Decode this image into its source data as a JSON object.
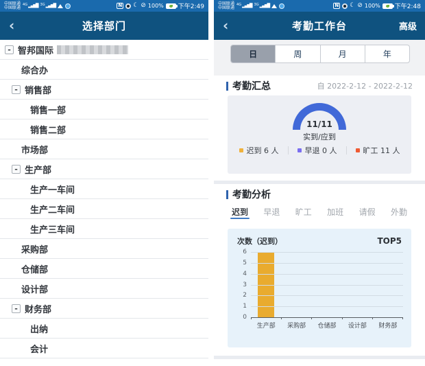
{
  "colors": {
    "status_bar_blue": "#1a6aad",
    "header_blue": "#0f527f",
    "section_bar_blue": "#2f63ad",
    "tab_underline_blue": "#3f7ac4",
    "gauge_blue": "#4169d8",
    "bar_yellow": "#e9ab2f",
    "legend_late_yellow": "#f0b23c",
    "legend_early_purple": "#7b6ef0",
    "legend_absent_red": "#ef5a33"
  },
  "glyphs": {
    "back": "‹",
    "minus": "-",
    "signal": "▂▄▆█",
    "nfc": "N",
    "moon": "☾",
    "mute": "⊘"
  },
  "left_screen": {
    "status": {
      "carrier_line1": "中国联通",
      "carrier_line2": "中国联通",
      "net1": "4G",
      "net2": "3G",
      "battery": "100%",
      "time": "下午2:49"
    },
    "header": {
      "title": "选择部门"
    },
    "tree": [
      {
        "label": "智邦国际",
        "level": 0,
        "expanded": true,
        "suffix_masked": true
      },
      {
        "label": "综合办",
        "level": 1
      },
      {
        "label": "销售部",
        "level": 1,
        "expanded": true
      },
      {
        "label": "销售一部",
        "level": 2
      },
      {
        "label": "销售二部",
        "level": 2
      },
      {
        "label": "市场部",
        "level": 1
      },
      {
        "label": "生产部",
        "level": 1,
        "expanded": true
      },
      {
        "label": "生产一车间",
        "level": 2
      },
      {
        "label": "生产二车间",
        "level": 2
      },
      {
        "label": "生产三车间",
        "level": 2
      },
      {
        "label": "采购部",
        "level": 1
      },
      {
        "label": "仓储部",
        "level": 1
      },
      {
        "label": "设计部",
        "level": 1
      },
      {
        "label": "财务部",
        "level": 1,
        "expanded": true
      },
      {
        "label": "出纳",
        "level": 2
      },
      {
        "label": "会计",
        "level": 2
      }
    ]
  },
  "right_screen": {
    "status": {
      "carrier_line1": "中国联通",
      "carrier_line2": "中国联通",
      "net1": "4G",
      "net2": "3G",
      "battery": "100%",
      "time": "下午2:48"
    },
    "header": {
      "title": "考勤工作台",
      "action": "高级"
    },
    "period_tabs": [
      {
        "label": "日",
        "active": true
      },
      {
        "label": "周",
        "active": false
      },
      {
        "label": "月",
        "active": false
      },
      {
        "label": "年",
        "active": false
      }
    ],
    "summary": {
      "section_title": "考勤汇总",
      "date_range": "自 2022-2-12 - 2022-2-12",
      "gauge": {
        "value_text": "11/11",
        "label": "实到/应到",
        "percent": 100,
        "color": "#4169d8"
      },
      "legend": [
        {
          "text": "迟到 6 人",
          "color": "#f0b23c"
        },
        {
          "text": "早退 0 人",
          "color": "#7b6ef0"
        },
        {
          "text": "旷工 11 人",
          "color": "#ef5a33"
        }
      ]
    },
    "analysis": {
      "section_title": "考勤分析",
      "tabs": [
        {
          "label": "迟到",
          "active": true
        },
        {
          "label": "早退",
          "active": false
        },
        {
          "label": "旷工",
          "active": false
        },
        {
          "label": "加班",
          "active": false
        },
        {
          "label": "请假",
          "active": false
        },
        {
          "label": "外勤",
          "active": false
        }
      ]
    }
  },
  "chart_data": [
    {
      "type": "gauge",
      "title": "考勤汇总",
      "value": 11,
      "total": 11,
      "value_label": "11/11",
      "label": "实到/应到",
      "percent": 100,
      "legend": [
        {
          "name": "迟到",
          "value": 6,
          "unit": "人"
        },
        {
          "name": "早退",
          "value": 0,
          "unit": "人"
        },
        {
          "name": "旷工",
          "value": 11,
          "unit": "人"
        }
      ]
    },
    {
      "type": "bar",
      "title": "次数（迟到）",
      "badge": "TOP5",
      "categories": [
        "生产部",
        "采购部",
        "仓储部",
        "设计部",
        "财务部"
      ],
      "values": [
        6,
        0,
        0,
        0,
        0
      ],
      "ylim": [
        0,
        6
      ],
      "yticks": [
        0,
        1,
        2,
        3,
        4,
        5,
        6
      ],
      "bar_color": "#e9ab2f",
      "grid": true
    }
  ]
}
